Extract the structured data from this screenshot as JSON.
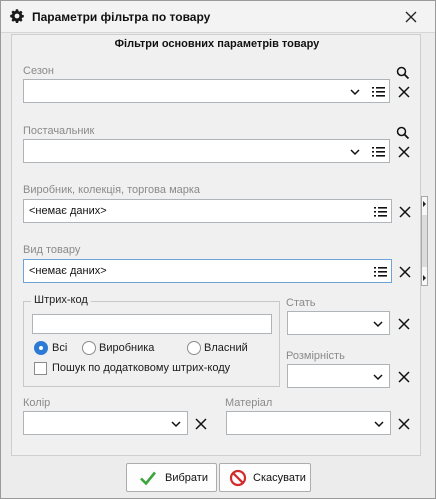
{
  "window": {
    "title": "Параметри фільтра по товару",
    "title_icon": "gear-icon",
    "close_icon": "close-icon"
  },
  "panel": {
    "header": "Фільтри основних параметрів товару"
  },
  "fields": {
    "season": {
      "label": "Сезон",
      "value": ""
    },
    "supplier": {
      "label": "Постачальник",
      "value": ""
    },
    "manufacturer": {
      "label": "Виробник, колекція, торгова марка",
      "value": "<немає даних>"
    },
    "product_type": {
      "label": "Вид товару",
      "value": "<немає даних>"
    },
    "gender": {
      "label": "Стать",
      "value": ""
    },
    "size_grid": {
      "label": "Розмірність",
      "value": ""
    },
    "color": {
      "label": "Колір",
      "value": ""
    },
    "material": {
      "label": "Матеріал",
      "value": ""
    }
  },
  "barcode": {
    "group_title": "Штрих-код",
    "value": "",
    "radios": [
      {
        "label": "Всі",
        "checked": true
      },
      {
        "label": "Виробника",
        "checked": false
      },
      {
        "label": "Власний",
        "checked": false
      }
    ],
    "checkbox_label": "Пошук по додатковому штрих-коду",
    "checkbox_checked": false
  },
  "buttons": {
    "ok": "Вибрати",
    "cancel": "Скасувати"
  },
  "colors": {
    "accent": "#2b7bd6",
    "ok_icon": "#3aa53a",
    "cancel_icon": "#d22b2b"
  }
}
